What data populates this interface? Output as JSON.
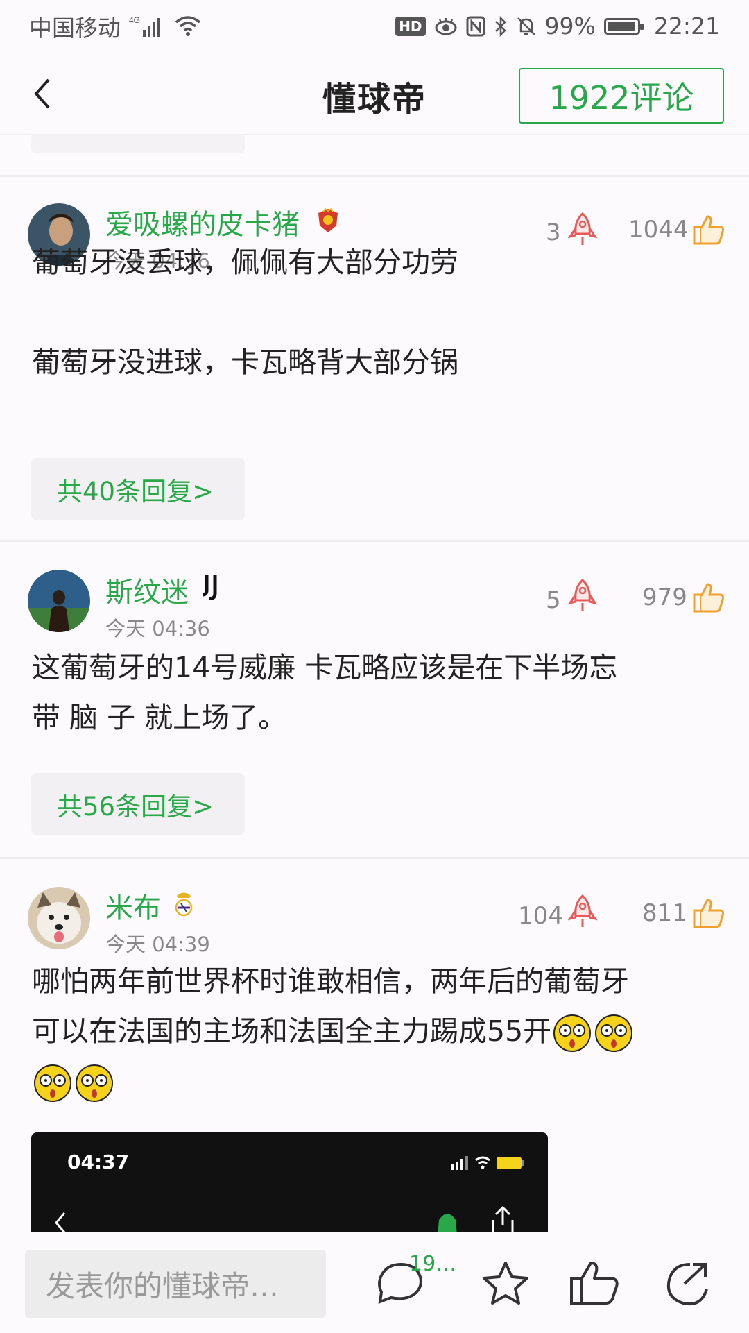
{
  "status_bar": {
    "carrier": "中国移动",
    "network": "4G",
    "battery": "99%",
    "battery_level": 0.99,
    "time": "22:21",
    "hd": "HD"
  },
  "nav": {
    "title": "懂球帝",
    "comments_button": "1922评论"
  },
  "comments": [
    {
      "username": "爱吸螺的皮卡猪",
      "time": "今天 04:36",
      "rockets": "3",
      "likes": "1044",
      "lines": [
        "葡萄牙没丢球，佩佩有大部分功劳",
        "",
        "葡萄牙没进球，卡瓦略背大部分锅"
      ],
      "replies": "共40条回复>"
    },
    {
      "username": "斯纹迷",
      "time": "今天 04:36",
      "rockets": "5",
      "likes": "979",
      "lines": [
        "这葡萄牙的14号威廉 卡瓦略应该是在下半场忘",
        "带 脑 子 就上场了。"
      ],
      "replies": "共56条回复>"
    },
    {
      "username": "米布",
      "time": "今天 04:39",
      "rockets": "104",
      "likes": "811",
      "lines": [
        "哪怕两年前世界杯时谁敢相信，两年后的葡萄牙",
        "可以在法国的主场和法国全主力踢成55开"
      ]
    }
  ],
  "image_preview": {
    "time": "04:37"
  },
  "bottom": {
    "input_placeholder": "发表你的懂球帝…",
    "comment_count": "19…"
  },
  "colors": {
    "accent": "#29a84a",
    "rocket": "#e85a5a",
    "like": "#f0a030"
  }
}
